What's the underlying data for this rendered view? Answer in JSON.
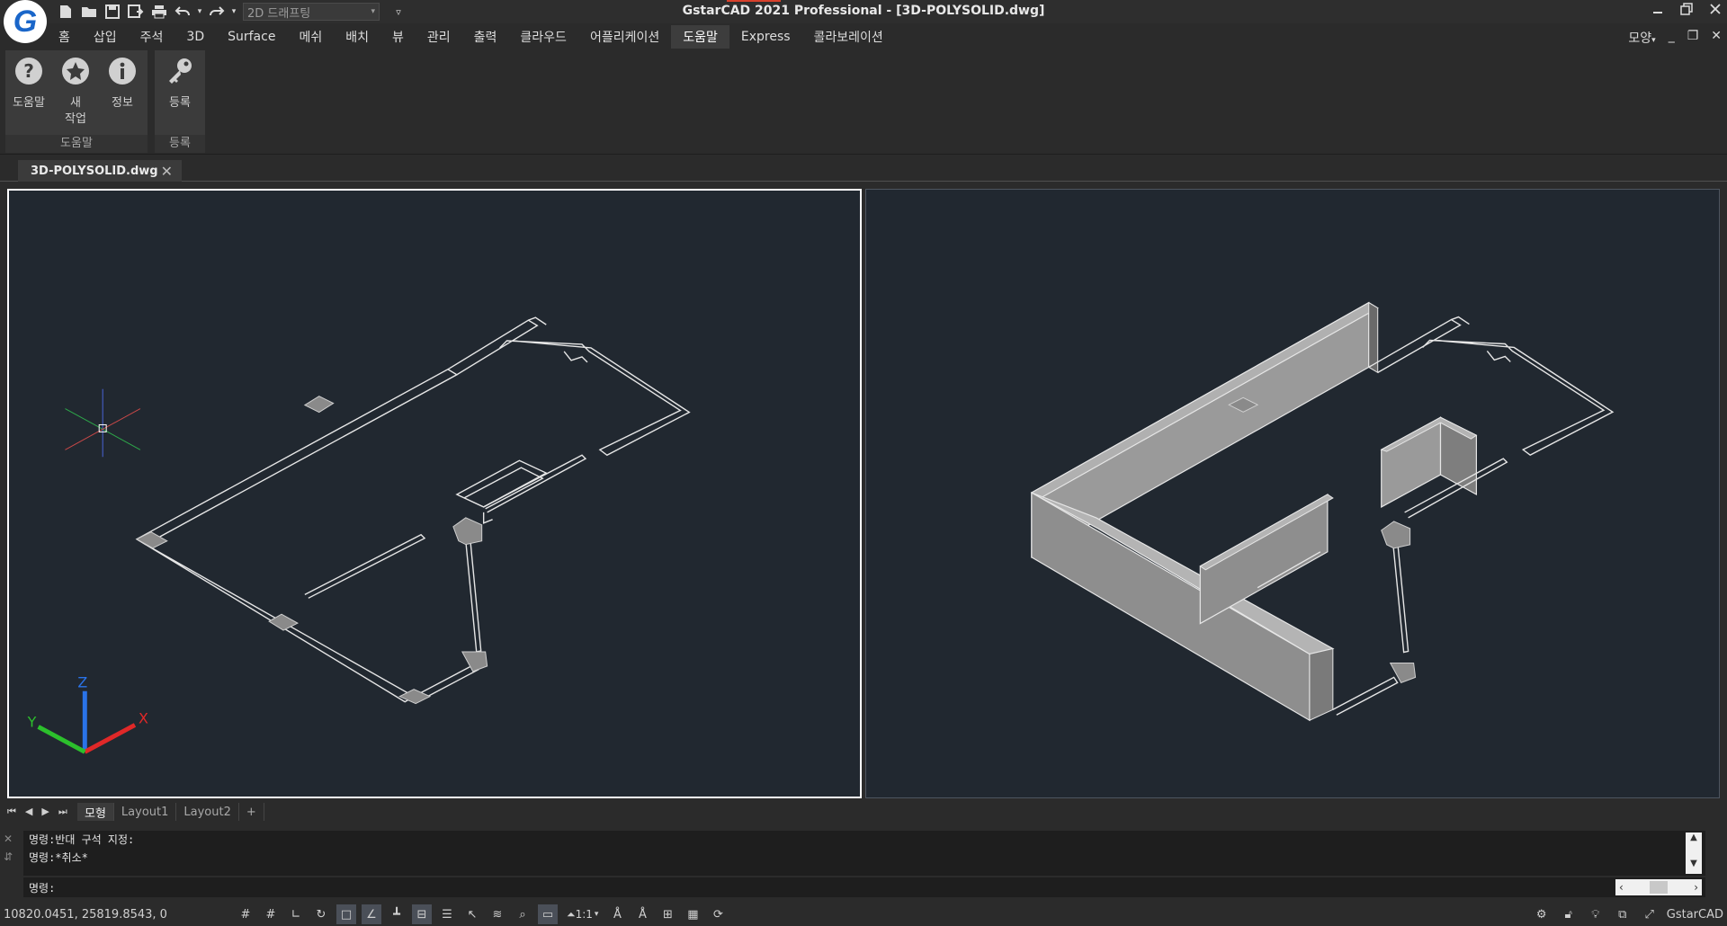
{
  "app": {
    "title": "GstarCAD 2021 Professional - [3D-POLYSOLID.dwg]",
    "logo_letter": "G",
    "brand_color": "#1a66c9",
    "window_controls": [
      "minimize-icon",
      "restore-icon",
      "close-icon"
    ]
  },
  "quick_access": {
    "icons": [
      "new-file-icon",
      "open-file-icon",
      "save-icon",
      "save-as-icon",
      "print-icon",
      "undo-icon",
      "redo-icon"
    ],
    "workspace": "2D 드래프팅",
    "customize": "▿"
  },
  "menu": {
    "items": [
      "홈",
      "삽입",
      "주석",
      "3D",
      "Surface",
      "메쉬",
      "배치",
      "뷰",
      "관리",
      "출력",
      "클라우드",
      "어플리케이션",
      "도움말",
      "Express",
      "콜라보레이션"
    ],
    "active": "도움말",
    "right_label": "모양"
  },
  "ribbon": {
    "panels": [
      {
        "title": "도움말",
        "buttons": [
          {
            "label": "도움말",
            "icon": "help-icon"
          },
          {
            "label": "새\n작업",
            "icon": "star-icon"
          },
          {
            "label": "정보",
            "icon": "info-icon"
          }
        ]
      },
      {
        "title": "등록",
        "buttons": [
          {
            "label": "등록",
            "icon": "key-icon"
          }
        ]
      }
    ]
  },
  "document": {
    "tab_name": "3D-POLYSOLID.dwg",
    "close": "✕"
  },
  "layout_tabs": {
    "tabs": [
      "모형",
      "Layout1",
      "Layout2",
      "+"
    ],
    "active": "모형"
  },
  "ucs": {
    "x": "X",
    "y": "Y",
    "z": "Z",
    "colors": {
      "x": "#e02828",
      "y": "#2cc02c",
      "z": "#2a73e8"
    }
  },
  "command": {
    "history": [
      "명령:반대 구석 지정:",
      "명령:*취소*"
    ],
    "prompt": "명령:"
  },
  "status": {
    "coordinates": "10820.0451, 25819.8543, 0",
    "scale": "1:1",
    "app_name": "GstarCAD"
  }
}
